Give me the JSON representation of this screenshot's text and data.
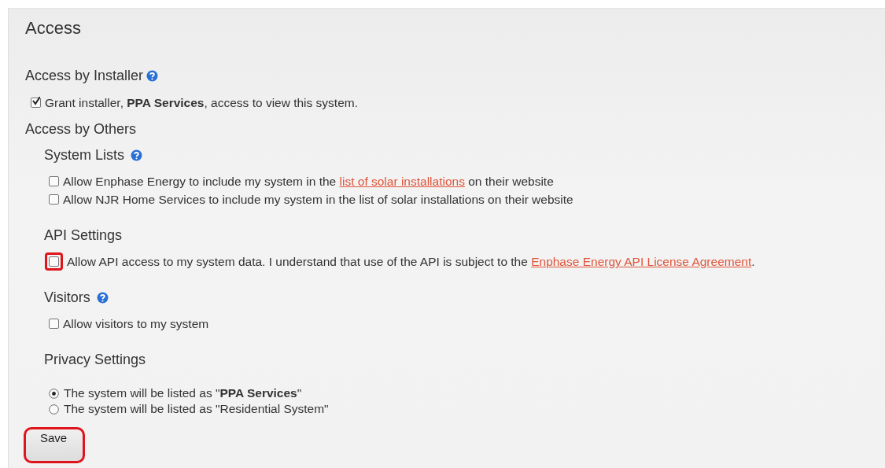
{
  "title": "Access",
  "installer": {
    "heading": "Access by Installer",
    "help": true,
    "grant": {
      "text": "Grant installer, **PPA Services**, access to view this system.",
      "checked": true
    }
  },
  "others": {
    "heading": "Access by Others",
    "sections": [
      {
        "heading": "System Lists",
        "help": true,
        "kind": "checkboxes",
        "items": [
          {
            "before": "Allow Enphase Energy to include my system in the ",
            "link": "list of solar installations",
            "after": " on their website",
            "checked": false,
            "highlighted": false
          },
          {
            "before": "Allow NJR Home Services to include my system in the list of solar installations on their website",
            "checked": false,
            "highlighted": false
          }
        ]
      },
      {
        "heading": "API Settings",
        "help": false,
        "kind": "checkboxes",
        "items": [
          {
            "before": "Allow API access to my system data. I understand that use of the API is subject to the ",
            "link": "Enphase Energy API License Agreement",
            "after": ".",
            "checked": false,
            "highlighted": true
          }
        ]
      },
      {
        "heading": "Visitors",
        "help": true,
        "kind": "checkboxes",
        "items": [
          {
            "before": "Allow visitors to my system",
            "checked": false,
            "highlighted": false
          }
        ]
      },
      {
        "heading": "Privacy Settings",
        "help": false,
        "kind": "radios",
        "items": [
          {
            "text": "The system will be listed as \"**PPA Services**\"",
            "selected": true
          },
          {
            "text": "The system will be listed as \"Residential System\"",
            "selected": false
          }
        ]
      }
    ]
  },
  "save": {
    "label": "Save",
    "highlighted": true
  }
}
